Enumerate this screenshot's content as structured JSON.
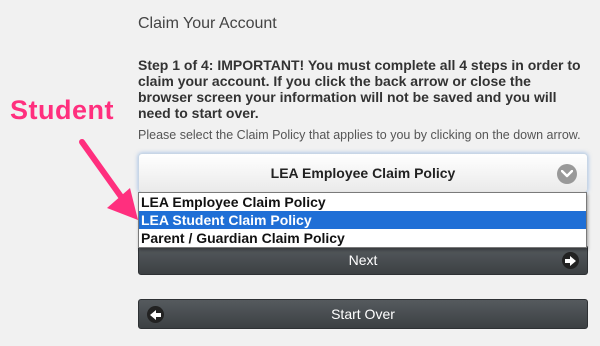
{
  "page": {
    "title": "Claim Your Account",
    "warning": "Step 1 of 4: IMPORTANT! You must complete all 4 steps in order to claim your account. If you click the back arrow or close the browser screen your information will not be saved and you will need to start over.",
    "instruction": "Please select the Claim Policy that applies to you by clicking on the down arrow."
  },
  "annotation": {
    "label": "Student",
    "color": "#ff2f7e"
  },
  "policy_select": {
    "selected_value": "LEA Employee Claim Policy",
    "icon": "chevron-down-icon",
    "options": [
      {
        "label": "LEA Employee Claim Policy",
        "highlighted": false
      },
      {
        "label": "LEA Student Claim Policy",
        "highlighted": true
      },
      {
        "label": "Parent / Guardian Claim Policy",
        "highlighted": false
      }
    ],
    "highlight_color": "#1f6fd6"
  },
  "buttons": {
    "next_label": "Next",
    "next_icon": "arrow-right-icon",
    "start_over_label": "Start Over",
    "start_over_icon": "arrow-left-icon"
  }
}
